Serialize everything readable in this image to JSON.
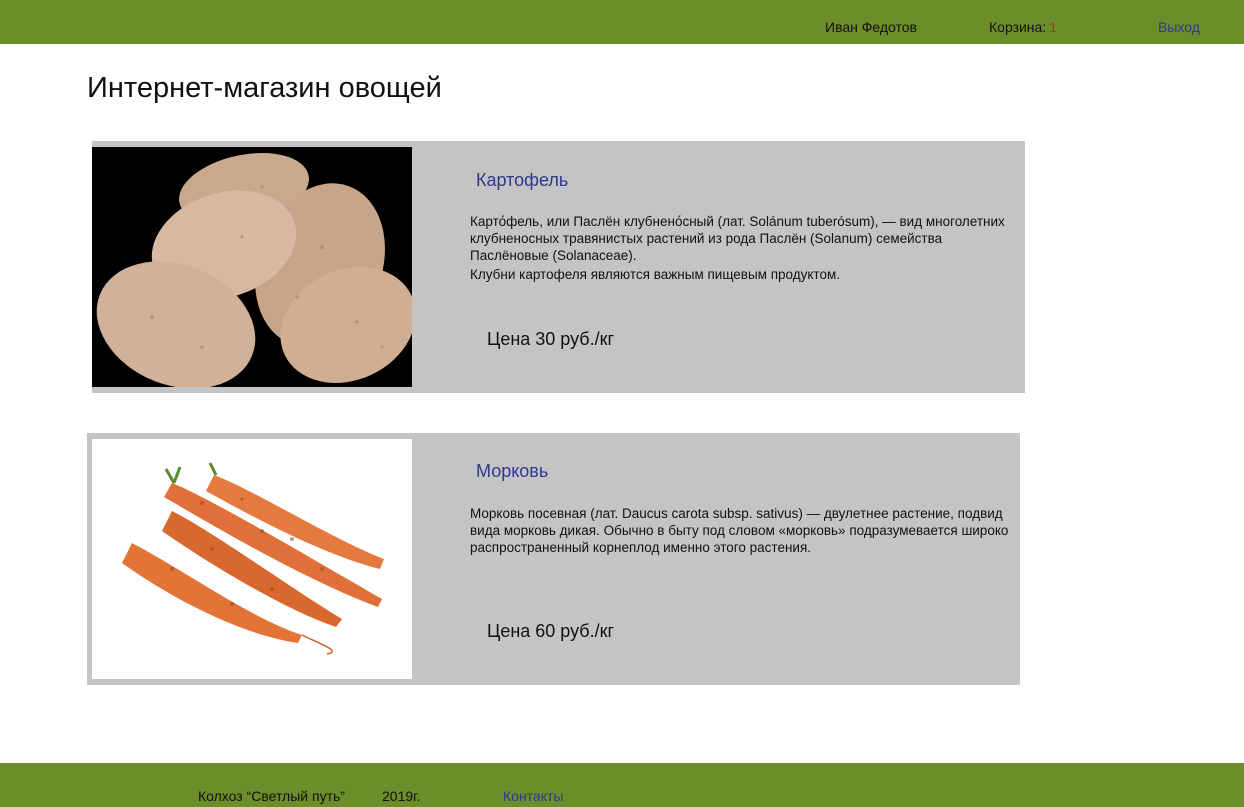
{
  "header": {
    "user_name": "Иван Федотов",
    "cart_label": "Корзина:",
    "cart_count": "1",
    "logout_label": "Выход"
  },
  "page_title": "Интернет-магазин овощей",
  "products": [
    {
      "name": "Картофель",
      "image_icon": "potato-image",
      "description": [
        "Карто́фель, или Паслён клубнено́сный (лат. Solánum tuberósum), — вид многолетних клубненосных травянистых растений из рода Паслён (Solanum) семейства Паслёновые (Solanaceae).",
        "Клубни картофеля являются важным пищевым продуктом."
      ],
      "price": "Цена 30 руб./кг"
    },
    {
      "name": "Морковь",
      "image_icon": "carrot-image",
      "description": [
        "Морковь посевная (лат. Daucus carota subsp. sativus) — двулетнее растение, подвид вида морковь дикая. Обычно в быту под словом «морковь» подразумевается широко распространенный корнеплод именно этого растения."
      ],
      "price": "Цена 60 руб./кг"
    }
  ],
  "footer": {
    "org": "Колхоз “Светлый путь”",
    "year": "2019г.",
    "contacts_label": "Контакты"
  },
  "colors": {
    "bar_green": "#6b8e2a",
    "card_gray": "#c4c4c4",
    "link_blue": "#2d3a8c",
    "cart_red": "#d9261c"
  }
}
